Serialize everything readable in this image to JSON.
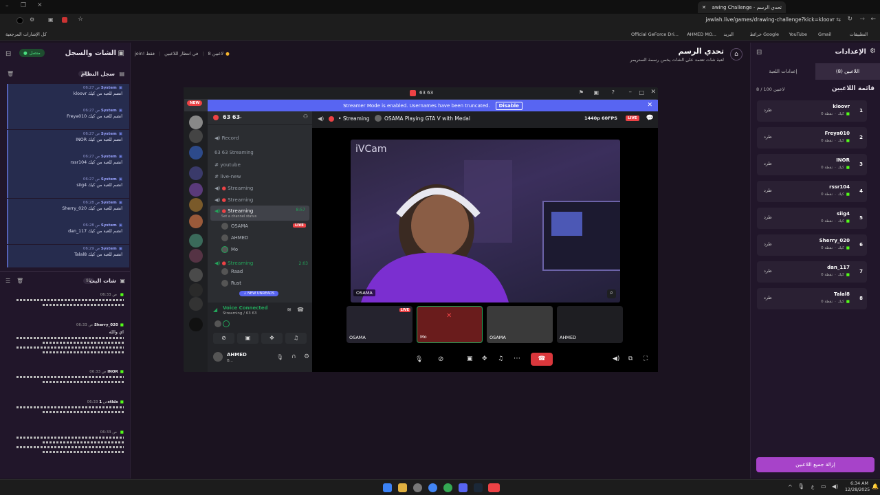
{
  "browser": {
    "tab_title": "awing Challenge - تحدي الرسم",
    "url": "jawlah.live/games/drawing-challenge?kick=kloovr",
    "bookmarks": [
      "كل الإشارات المرجعية",
      "التطبيقات",
      "Gmail",
      "YouTube",
      "خرائط Google",
      "البريد",
      "AHMED MO...",
      "Official GeForce Dri..."
    ]
  },
  "left_panel": {
    "title": "الشات والسجل",
    "status": "متصل",
    "system_log_title": "سجل النظام",
    "system_log_count": "11",
    "system_messages": [
      {
        "sender": "System",
        "time": "06:27 ص",
        "text": "kloovr انضم للعبة من كيك"
      },
      {
        "sender": "System",
        "time": "06:27 ص",
        "text": "Freya010 انضم للعبة من كيك"
      },
      {
        "sender": "System",
        "time": "06:27 ص",
        "text": "INOR انضم للعبة من كيك"
      },
      {
        "sender": "System",
        "time": "06:27 ص",
        "text": "rssr104 انضم للعبة من كيك"
      },
      {
        "sender": "System",
        "time": "06:27 ص",
        "text": "siig4 انضم للعبة من كيك"
      },
      {
        "sender": "System",
        "time": "06:28 ص",
        "text": "Sherry_020 انضم للعبة من كيك"
      },
      {
        "sender": "System",
        "time": "06:28 ص",
        "text": "dan_117 انضم للعبة من كيك"
      },
      {
        "sender": "System",
        "time": "06:29 ص",
        "text": "Talal8 انضم للعبة من كيك"
      }
    ],
    "live_chat_title": "شات البث",
    "live_chat_count": "91",
    "chat_messages": [
      {
        "user": "",
        "time": "06:33 ص",
        "text": ""
      },
      {
        "user": "Sherry_020",
        "time": "06:33 ص",
        "text": "اي والله"
      },
      {
        "user": "INOR",
        "time": "06:33 ص",
        "text": ""
      },
      {
        "user": "1stldx",
        "time": "06:33 ص",
        "text": ""
      },
      {
        "user": "",
        "time": "06:33 ص",
        "text": ""
      }
    ]
  },
  "header": {
    "title": "تحدي الرسم",
    "subtitle": "لعبة شات تعتمد على الشات يخمن رسمة الستريمر",
    "players_badge": "8 لاعبين",
    "waiting_badge": "في انتظار اللاعبين",
    "join_badge": "join! فقط"
  },
  "discord": {
    "title": "63 63",
    "banner_text": "Streamer Mode is enabled. Usernames have been truncated.",
    "banner_button": "Disable",
    "new_badge": "NEW",
    "server_name": "63 63",
    "channel_category": "63 63 Streaming",
    "channels": [
      "Record",
      "youtube",
      "live-new",
      "Streaming",
      "Streaming",
      "Streaming",
      "Streaming"
    ],
    "active_channel_status": "Set a channel status",
    "active_time": "8:57",
    "second_time": "2:03",
    "voice_users": [
      "OSAMA",
      "AHMED",
      "Mo",
      "Raad",
      "Rust"
    ],
    "live_badge": "LIVE",
    "new_unreads": "NEW UNREADS",
    "voice_connected": "Voice Connected",
    "voice_sub": "Streaming / 63 63",
    "user_name": "AHMED",
    "user_sub": "B...",
    "stream_label": "Streaming",
    "stream_title": "OSAMA Playing GTA V with Medal",
    "quality": "1440p 60FPS",
    "ivcam": "iVCam",
    "stream_name_tag": "OSAMA",
    "tiles": [
      "OSAMA",
      "Mo",
      "OSAMA",
      "AHMED"
    ]
  },
  "right_panel": {
    "title": "الإعدادات",
    "tab_players": "اللاعبين (8)",
    "tab_game_settings": "إعدادات اللعبة",
    "list_title": "قائمة اللاعبين",
    "count": "8 / 100 لاعبين",
    "kick_label": "طرد",
    "points_label": "0 نقطة",
    "platform_label": "كيك",
    "players": [
      "kloovr",
      "Freya010",
      "INOR",
      "rssr104",
      "siig4",
      "Sherry_020",
      "dan_117",
      "Talal8"
    ],
    "remove_all": "إزالة جميع اللاعبين"
  },
  "taskbar": {
    "time": "6:34 AM",
    "date": "12/28/2025"
  },
  "colors": {
    "accent": "#a743c9",
    "discord": "#5865f2",
    "live": "#ed4245",
    "green": "#23a55a"
  }
}
